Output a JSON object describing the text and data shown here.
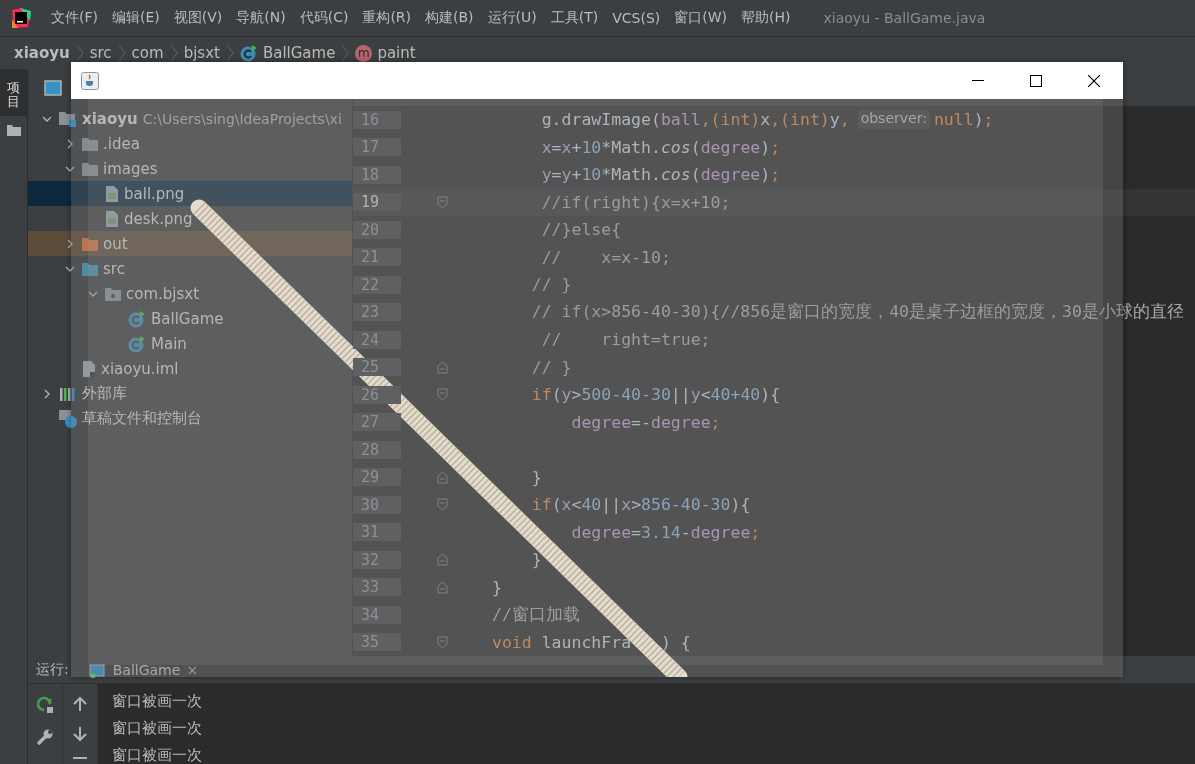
{
  "menu_bar": {
    "items": [
      "文件(F)",
      "编辑(E)",
      "视图(V)",
      "导航(N)",
      "代码(C)",
      "重构(R)",
      "构建(B)",
      "运行(U)",
      "工具(T)",
      "VCS(S)",
      "窗口(W)",
      "帮助(H)"
    ],
    "title": "xiaoyu - BallGame.java"
  },
  "breadcrumb": [
    {
      "label": "xiaoyu",
      "kind": "project"
    },
    {
      "label": "src",
      "kind": "plain"
    },
    {
      "label": "com",
      "kind": "plain"
    },
    {
      "label": "bjsxt",
      "kind": "plain"
    },
    {
      "label": "BallGame",
      "kind": "class"
    },
    {
      "label": "paint",
      "kind": "method",
      "icon_letter": "m"
    }
  ],
  "side_strip": {
    "tab": "项目"
  },
  "project": {
    "tree": [
      {
        "label": "xiaoyu",
        "path": "C:\\Users\\sing\\IdeaProjects\\xi",
        "kind": "module",
        "expanded": true,
        "selected": false,
        "children": [
          {
            "label": ".idea",
            "kind": "folder",
            "expanded": false,
            "selected": false
          },
          {
            "label": "images",
            "kind": "folder",
            "expanded": true,
            "selected": false,
            "children": [
              {
                "label": "ball.png",
                "kind": "image",
                "selected": true
              },
              {
                "label": "desk.png",
                "kind": "image",
                "selected": false
              }
            ]
          },
          {
            "label": "out",
            "kind": "excluded",
            "expanded": false,
            "selected": false
          },
          {
            "label": "src",
            "kind": "source",
            "expanded": true,
            "selected": false,
            "children": [
              {
                "label": "com.bjsxt",
                "kind": "package",
                "expanded": true,
                "selected": false,
                "children": [
                  {
                    "label": "BallGame",
                    "kind": "class",
                    "selected": false
                  },
                  {
                    "label": "Main",
                    "kind": "class",
                    "selected": false
                  }
                ]
              }
            ]
          },
          {
            "label": "xiaoyu.iml",
            "kind": "file",
            "selected": false
          }
        ]
      },
      {
        "label": "外部库",
        "kind": "library",
        "expanded": false,
        "selected": false
      },
      {
        "label": "草稿文件和控制台",
        "kind": "scratch",
        "selected": false
      }
    ]
  },
  "editor": {
    "lines": [
      {
        "number": "16",
        "current": false,
        "kind": "code",
        "segments": [
          {
            "kind": "plain",
            "text": "     g.drawImage("
          },
          {
            "kind": "field",
            "text": "ball"
          },
          {
            "kind": "keyword",
            "text": ",(int)"
          },
          {
            "kind": "plain",
            "text": "x"
          },
          {
            "kind": "keyword",
            "text": ",(int)"
          },
          {
            "kind": "plain",
            "text": "y"
          },
          {
            "kind": "keyword",
            "text": ","
          },
          {
            "kind": "hint",
            "text": "observer:"
          },
          {
            "kind": "keyword",
            "text": "null"
          },
          {
            "kind": "plain",
            "text": ")"
          },
          {
            "kind": "keyword",
            "text": ";"
          }
        ]
      },
      {
        "number": "17",
        "current": false,
        "kind": "code",
        "segments": [
          {
            "kind": "field",
            "text": "     x"
          },
          {
            "kind": "plain",
            "text": "="
          },
          {
            "kind": "field",
            "text": "x"
          },
          {
            "kind": "plain",
            "text": "+"
          },
          {
            "kind": "number",
            "text": "10"
          },
          {
            "kind": "plain",
            "text": "*Math."
          },
          {
            "kind": "static",
            "text": "cos"
          },
          {
            "kind": "plain",
            "text": "("
          },
          {
            "kind": "field",
            "text": "degree"
          },
          {
            "kind": "plain",
            "text": ")"
          },
          {
            "kind": "keyword",
            "text": ";"
          }
        ]
      },
      {
        "number": "18",
        "current": false,
        "kind": "code",
        "segments": [
          {
            "kind": "field",
            "text": "     y"
          },
          {
            "kind": "plain",
            "text": "="
          },
          {
            "kind": "field",
            "text": "y"
          },
          {
            "kind": "plain",
            "text": "+"
          },
          {
            "kind": "number",
            "text": "10"
          },
          {
            "kind": "plain",
            "text": "*Math."
          },
          {
            "kind": "static",
            "text": "cos"
          },
          {
            "kind": "plain",
            "text": "("
          },
          {
            "kind": "field",
            "text": "degree"
          },
          {
            "kind": "plain",
            "text": ")"
          },
          {
            "kind": "keyword",
            "text": ";"
          }
        ]
      },
      {
        "number": "19",
        "current": true,
        "kind": "fold-start",
        "segments": [
          {
            "kind": "comment",
            "text": "     //if(right){x=x+10;"
          }
        ]
      },
      {
        "number": "20",
        "current": false,
        "kind": "code",
        "segments": [
          {
            "kind": "comment",
            "text": "     //}else{"
          }
        ]
      },
      {
        "number": "21",
        "current": false,
        "kind": "code",
        "segments": [
          {
            "kind": "comment",
            "text": "     //    x=x-10;"
          }
        ]
      },
      {
        "number": "22",
        "current": false,
        "kind": "code",
        "segments": [
          {
            "kind": "comment",
            "text": "    // }"
          }
        ]
      },
      {
        "number": "23",
        "current": false,
        "kind": "code",
        "segments": [
          {
            "kind": "comment",
            "text": "    // if(x>856-40-30){//856是窗口的宽度，40是桌子边框的宽度，30是小球的直径"
          }
        ]
      },
      {
        "number": "24",
        "current": false,
        "kind": "code",
        "segments": [
          {
            "kind": "comment",
            "text": "     //    right=true;"
          }
        ]
      },
      {
        "number": "25",
        "current": false,
        "kind": "fold-end",
        "segments": [
          {
            "kind": "comment",
            "text": "    // }"
          }
        ]
      },
      {
        "number": "26",
        "current": false,
        "kind": "fold-start",
        "segments": [
          {
            "kind": "keyword",
            "text": "    if"
          },
          {
            "kind": "plain",
            "text": "("
          },
          {
            "kind": "field",
            "text": "y"
          },
          {
            "kind": "plain",
            "text": ">"
          },
          {
            "kind": "number",
            "text": "500-40-30"
          },
          {
            "kind": "plain",
            "text": "||"
          },
          {
            "kind": "field",
            "text": "y"
          },
          {
            "kind": "plain",
            "text": "<"
          },
          {
            "kind": "number",
            "text": "40+40"
          },
          {
            "kind": "plain",
            "text": "){"
          }
        ]
      },
      {
        "number": "27",
        "current": false,
        "kind": "code",
        "segments": [
          {
            "kind": "field",
            "text": "        degree"
          },
          {
            "kind": "plain",
            "text": "=-"
          },
          {
            "kind": "field",
            "text": "degree"
          },
          {
            "kind": "keyword",
            "text": ";"
          }
        ]
      },
      {
        "number": "28",
        "current": false,
        "kind": "code"
      },
      {
        "number": "29",
        "current": false,
        "kind": "fold-end",
        "segments": [
          {
            "kind": "plain",
            "text": "    }"
          }
        ]
      },
      {
        "number": "30",
        "current": false,
        "kind": "fold-start",
        "segments": [
          {
            "kind": "keyword",
            "text": "    if"
          },
          {
            "kind": "plain",
            "text": "("
          },
          {
            "kind": "field",
            "text": "x"
          },
          {
            "kind": "plain",
            "text": "<"
          },
          {
            "kind": "number",
            "text": "40"
          },
          {
            "kind": "plain",
            "text": "||"
          },
          {
            "kind": "field",
            "text": "x"
          },
          {
            "kind": "plain",
            "text": ">"
          },
          {
            "kind": "number",
            "text": "856-40-30"
          },
          {
            "kind": "plain",
            "text": "){"
          }
        ]
      },
      {
        "number": "31",
        "current": false,
        "kind": "code",
        "segments": [
          {
            "kind": "field",
            "text": "        degree"
          },
          {
            "kind": "plain",
            "text": "="
          },
          {
            "kind": "number",
            "text": "3.14"
          },
          {
            "kind": "plain",
            "text": "-"
          },
          {
            "kind": "field",
            "text": "degree"
          },
          {
            "kind": "keyword",
            "text": ";"
          }
        ]
      },
      {
        "number": "32",
        "current": false,
        "kind": "fold-end",
        "segments": [
          {
            "kind": "plain",
            "text": "    }"
          }
        ]
      },
      {
        "number": "33",
        "current": false,
        "kind": "fold-end",
        "segments": [
          {
            "kind": "plain",
            "text": "}"
          }
        ]
      },
      {
        "number": "34",
        "current": false,
        "kind": "code",
        "segments": [
          {
            "kind": "comment",
            "text": "//窗口加载"
          }
        ]
      },
      {
        "number": "35",
        "current": false,
        "kind": "fold-start",
        "segments": [
          {
            "kind": "keyword",
            "text": "void"
          },
          {
            "kind": "plain",
            "text": " launchFra"
          },
          {
            "kind": "plain",
            "text": "   ) {"
          }
        ]
      }
    ]
  },
  "run_panel": {
    "label": "运行:",
    "tab": {
      "label": "BallGame",
      "close": "×"
    },
    "output": [
      "窗口被画一次",
      "窗口被画一次",
      "窗口被画一次"
    ]
  }
}
